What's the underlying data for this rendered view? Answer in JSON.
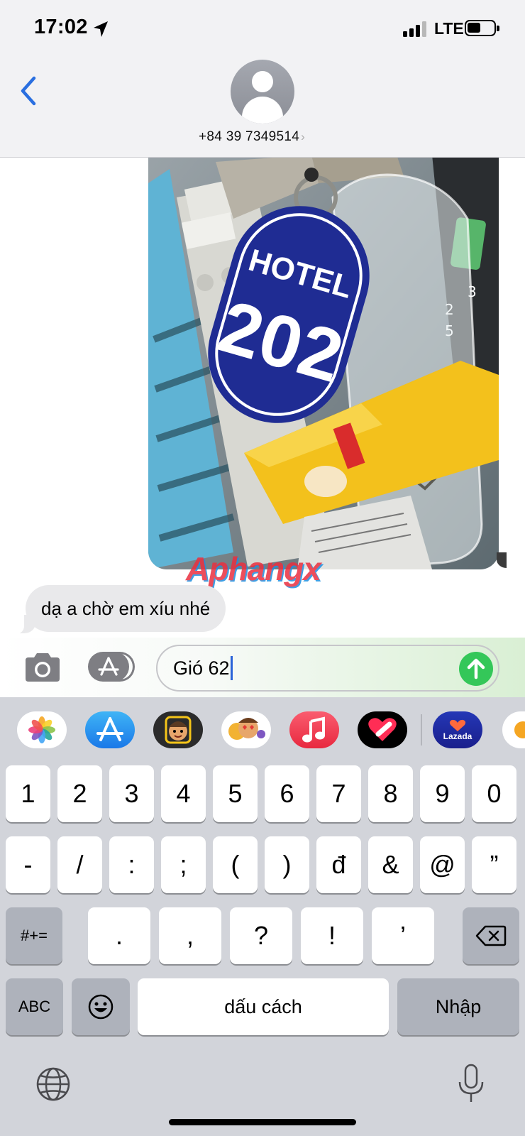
{
  "status_bar": {
    "time": "17:02",
    "network": "LTE",
    "location_icon": "location-arrow-icon",
    "signal_bars_active": 3,
    "signal_bars_total": 4,
    "battery_level": 0.4
  },
  "header": {
    "contact_name": "+84 39 7349514",
    "chevron": "›",
    "back_icon": "chevron-left-icon",
    "avatar_icon": "person-silhouette-icon"
  },
  "messages": [
    {
      "type": "image",
      "direction": "sent",
      "depicts": "hotel-key-tag",
      "image_text": {
        "line1": "HOTEL",
        "line2": "202"
      },
      "watermark": "Aphangx"
    },
    {
      "type": "text",
      "direction": "received",
      "text": "dạ a chờ em xíu nhé"
    }
  ],
  "composer": {
    "value": "Gió 62",
    "camera_icon": "camera-icon",
    "apps_icon": "app-store-icon",
    "send_icon": "arrow-up-icon",
    "send_color": "#34c759"
  },
  "app_strip": [
    {
      "name": "Photos",
      "icon": "photos-icon"
    },
    {
      "name": "App Store",
      "icon": "app-store-icon"
    },
    {
      "name": "Memoji",
      "icon": "memoji-icon"
    },
    {
      "name": "Memoji Stickers",
      "icon": "memoji-stickers-icon"
    },
    {
      "name": "Music",
      "icon": "music-icon"
    },
    {
      "name": "Digital Touch",
      "icon": "digital-touch-icon"
    },
    {
      "name": "Lazada",
      "icon": "lazada-icon",
      "label": "Lazada"
    },
    {
      "name": "More",
      "icon": "more-app-icon"
    }
  ],
  "keyboard": {
    "row1": [
      "1",
      "2",
      "3",
      "4",
      "5",
      "6",
      "7",
      "8",
      "9",
      "0"
    ],
    "row2": [
      "-",
      "/",
      ":",
      ";",
      "(",
      ")",
      "đ",
      "&",
      "@",
      "”"
    ],
    "row3": [
      ".",
      ",",
      "?",
      "!",
      "’"
    ],
    "symbols_label": "#+=",
    "abc_label": "ABC",
    "space_label": "dấu cách",
    "return_label": "Nhập",
    "delete_icon": "backspace-icon",
    "emoji_icon": "emoji-icon",
    "globe_icon": "globe-icon",
    "mic_icon": "microphone-icon"
  },
  "colors": {
    "accent_blue": "#2a6fe0",
    "header_bg": "#f2f2f4",
    "keyboard_bg": "#d2d4da",
    "received_bubble": "#e9e9eb"
  }
}
